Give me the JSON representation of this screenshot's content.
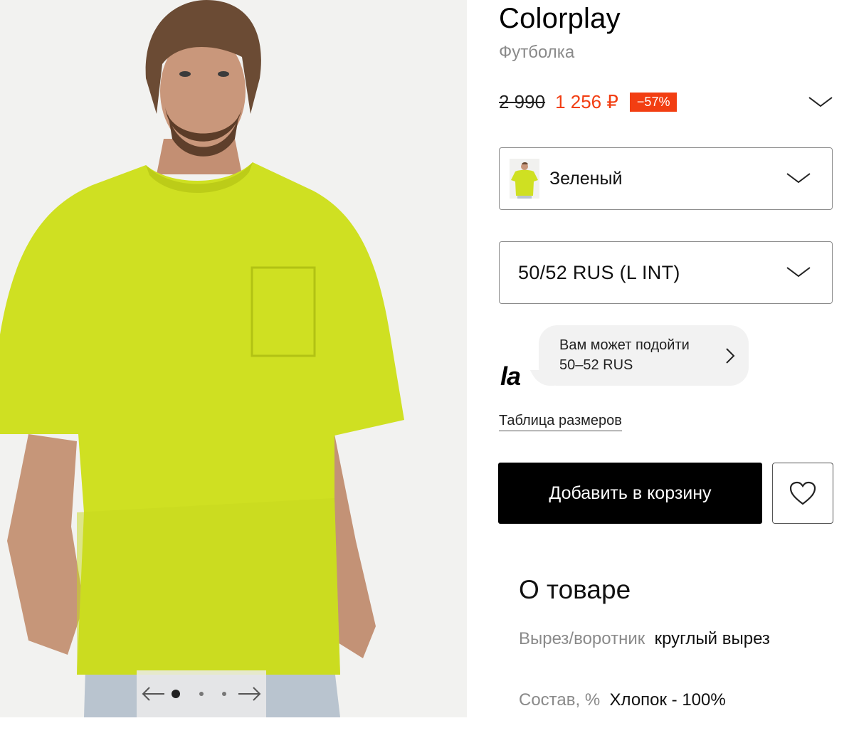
{
  "product": {
    "brand": "Colorplay",
    "type": "Футболка"
  },
  "price": {
    "old": "2 990",
    "new": "1 256 ₽",
    "discount": "−57%",
    "new_color": "#f23e12"
  },
  "gallery": {
    "image_description_icon": "product-photo",
    "total_images": 3,
    "active_index": 1,
    "shirt_color": "#cfe022"
  },
  "color_select": {
    "label": "Зеленый"
  },
  "size_select": {
    "label": "50/52 RUS (L INT)"
  },
  "fit_hint": {
    "logo": "la",
    "line1": "Вам может подойти",
    "line2": "50–52 RUS"
  },
  "size_table_link": "Таблица размеров",
  "add_to_cart": "Добавить в корзину",
  "about": {
    "title": "О товаре",
    "attributes": [
      {
        "key": "Вырез/воротник",
        "value": "круглый вырез"
      },
      {
        "key": "Состав, %",
        "value": "Хлопок - 100%"
      }
    ]
  }
}
